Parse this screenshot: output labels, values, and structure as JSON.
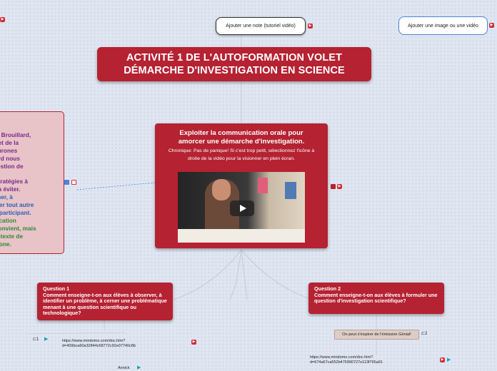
{
  "topics": {
    "note_pill": "Ajouter une note (tutoriel vidéo)",
    "image_pill": "Ajouter une image ou une vidéo"
  },
  "title": {
    "line1": "ACTIVITÉ 1 DE L'AUTOFORMATION VOLET",
    "line2": "DÉMARCHE D'INVESTIGATION EN SCIENCE"
  },
  "central": {
    "title_line1": "Exploiter la communication orale pour",
    "title_line2": "amorcer une démarche d'investigation.",
    "chronique": "Chronique: Pas de panique!  Si c'est trop petit, sélectionnez l'icône à droite de la vidéo pour la visionner en plein écran.",
    "video_icon": "play-icon"
  },
  "left_note": {
    "lines": [
      {
        "text": "rtin Brouillard,",
        "color": "#7b2a8c"
      },
      {
        "text": "es et de la",
        "color": "#7b2a8c"
      },
      {
        "text": "Neurones",
        "color": "#7b2a8c"
      },
      {
        "text": "illard nous",
        "color": "#7b2a8c"
      },
      {
        "text": " question de",
        "color": "#7b2a8c"
      },
      {
        "text": "he",
        "color": "#7b2a8c"
      },
      {
        "text": "s stratégies à",
        "color": "#7b2a8c"
      },
      {
        "text": "es à éviter.",
        "color": "#7b2a8c"
      },
      {
        "text": "onner, à",
        "color": "#2a5fb8"
      },
      {
        "text": "outer tout autre",
        "color": "#2a5fb8"
      },
      {
        "text": "tre participant.",
        "color": "#2a5fb8"
      },
      {
        "text": "unication",
        "color": "#2f8a3a"
      },
      {
        "text": "s convient, mais",
        "color": "#2f8a3a"
      },
      {
        "text": " contexte de",
        "color": "#2f8a3a"
      },
      {
        "text": "chrone.",
        "color": "#2f8a3a"
      }
    ]
  },
  "question1": {
    "label": "Question 1",
    "text": "Comment enseigne-t-on aux élèves à observer, à identifier un problème, à cerner une problématique menant à une question scientifique ou technologique?",
    "note_count": "1",
    "url": "https://www.mindomo.com/doc.htm?d=409bca60a32844c68772c92e07740c8b",
    "author": "Annick"
  },
  "question2": {
    "label": "Question 2",
    "text": "Comment enseigne-t-on aux élèves à formuler une question d'investigation scientifique?",
    "subtopic": "On peut s'inspirer de l'émission Génial!",
    "note_count": "2",
    "url": "https://www.mindomo.com/doc.htm?d=674a67ca552b476990727e113f765a91"
  },
  "colors": {
    "node_red": "#b52232",
    "background": "#dfe6f1",
    "icon_red": "#d42a36",
    "play_teal": "#1aa3b5"
  }
}
